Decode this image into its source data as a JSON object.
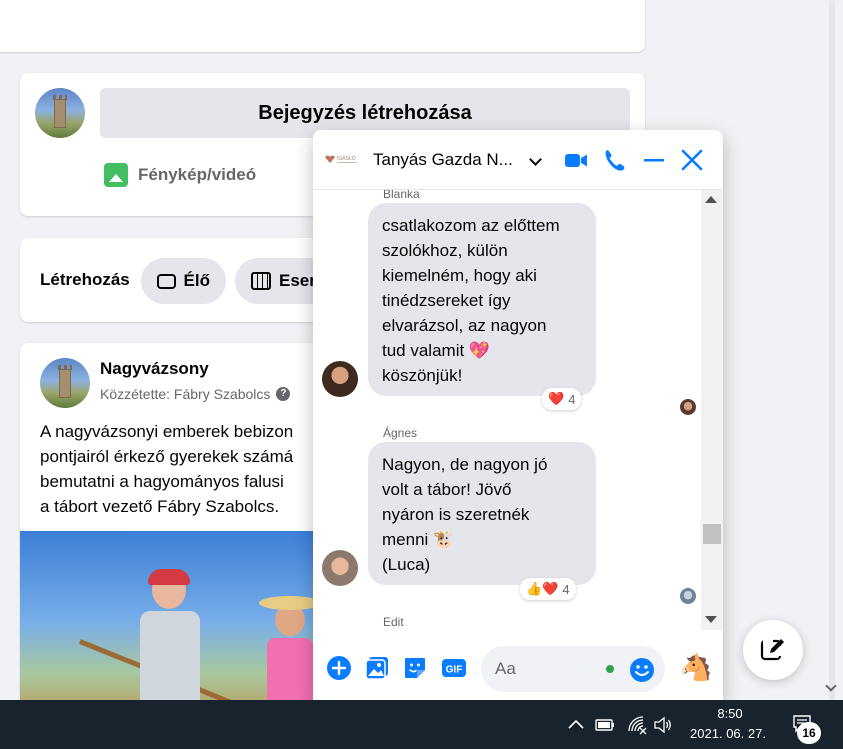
{
  "feed": {
    "create_post_label": "Bejegyzés létrehozása",
    "photo_video_label": "Fénykép/videó",
    "create_label": "Létrehozás",
    "live_label": "Élő",
    "event_label": "Esem"
  },
  "post": {
    "page_name": "Nagyvázsony",
    "posted_by": "Közzétette: Fábry Szabolcs",
    "privacy_icon": "?",
    "text_lines": [
      "A nagyvázsonyi emberek bebizon",
      "pontjairól érkező gyerekek számá",
      "bemutatni a hagyományos falusi",
      "a tábort vezető Fábry Szabolcs."
    ]
  },
  "chat": {
    "title": "Tanyás Gazda N...",
    "brand_logo_text": "IGÁSLÓ",
    "messages": [
      {
        "sender": "Blanka",
        "lines": [
          "csatlakozom az előttem",
          "szolókhoz, külön",
          "kiemelném, hogy aki",
          "tinédzsereket így",
          "elvarázsol, az nagyon",
          "tud valamit 💖",
          "köszönjük!"
        ],
        "reactions": "❤️",
        "reaction_count": "4"
      },
      {
        "sender": "Ágnes",
        "lines": [
          "Nagyon, de nagyon jó",
          "volt a tábor! Jövő",
          "nyáron is szeretnék",
          "menni 🐮",
          "(Luca)"
        ],
        "reactions": "👍❤️",
        "reaction_count": "4"
      },
      {
        "sender": "Edit"
      }
    ],
    "input_placeholder": "Aa",
    "quick_reaction": "🐴"
  },
  "taskbar": {
    "time": "8:50",
    "date": "2021. 06. 27.",
    "notification_count": "16"
  },
  "colors": {
    "accent": "#0084ff",
    "messenger_blue": "#0a7cff",
    "bubble_gray": "#e4e6eb",
    "taskbar": "#19232d"
  }
}
